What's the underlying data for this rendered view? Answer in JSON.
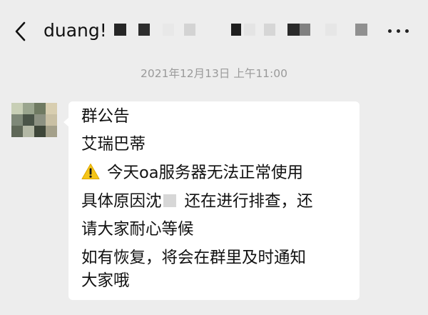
{
  "header": {
    "title": "duang!",
    "title_blocks": [
      {
        "tone": "#262626"
      },
      {
        "tone": "#2e2e2e"
      },
      {
        "tone": "#e8e8e8"
      },
      {
        "tone": "#d3d3d3"
      },
      {
        "tone": "#1f1f1f"
      },
      {
        "tone": "#e4e4e4"
      },
      {
        "tone": "#d6d6d6"
      },
      {
        "tone": "#2a2a2a"
      },
      {
        "tone": "#808080"
      },
      {
        "tone": "#e6e6e6"
      },
      {
        "tone": "#909090"
      }
    ]
  },
  "chat": {
    "timestamp": "2021年12月13日 上午11:00",
    "sender_avatar": {
      "tiles": [
        "#c8cfb6",
        "#9aa58e",
        "#6f7a62",
        "#d8ceb0",
        "#7e8878",
        "#4a5448",
        "#8c9182",
        "#c9c0a4",
        "#5f6858",
        "#b3b8a5",
        "#3e4639",
        "#a4a08a"
      ]
    },
    "message": {
      "line1": "群公告",
      "line2": "艾瑞巴蒂",
      "line3": "今天oa服务器无法正常使用",
      "line4_a": "具体原因沈",
      "line4_b": "还在进行排查，还",
      "line5": "请大家耐心等候",
      "line6": "如有恢复，将会在群里及时通知",
      "line7": "大家哦",
      "warning_icon": "warning-icon"
    }
  }
}
